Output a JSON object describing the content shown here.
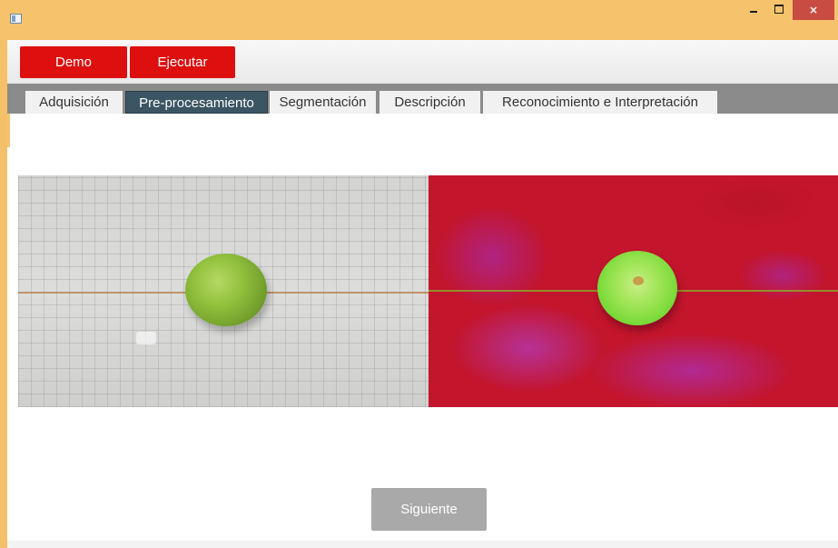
{
  "window": {
    "icon": "app-window-icon",
    "controls": {
      "minimize": "minimize-icon",
      "maximize": "maximize-icon",
      "close": "×"
    }
  },
  "toolbar": {
    "demo_label": "Demo",
    "run_label": "Ejecutar"
  },
  "tabs": [
    {
      "label": "Adquisición"
    },
    {
      "label": "Pre-procesamiento",
      "active": true
    },
    {
      "label": "Segmentación"
    },
    {
      "label": "Descripción"
    },
    {
      "label": "Reconocimiento e Interpretación"
    }
  ],
  "main": {
    "next_label": "Siguiente"
  },
  "colors": {
    "titlebar": "#f6c26c",
    "button_red": "#dd0f0f",
    "tab_active": "#3b5563",
    "tabstrip": "#8b8b8b",
    "next_button": "#a9a9a9",
    "close_red": "#c84c42"
  }
}
